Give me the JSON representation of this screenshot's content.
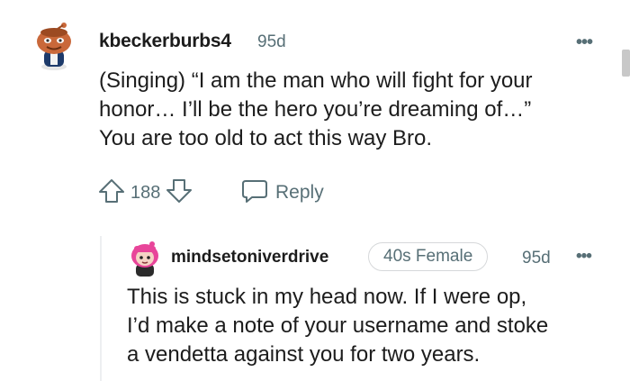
{
  "comment": {
    "username": "kbeckerburbs4",
    "age": "95d",
    "more_icon": "ellipsis-icon",
    "body_lines": [
      "(Singing) “I am the man who will fight for your",
      "honor… I’ll be the hero you’re dreaming of…”",
      "You are too old to act this way Bro."
    ],
    "votes": "188",
    "reply_label": "Reply"
  },
  "reply": {
    "username": "mindsetoniverdrive",
    "flair": "40s Female",
    "age": "95d",
    "more_icon": "ellipsis-icon",
    "body_lines": [
      "This is stuck in my head now. If I were op,",
      "I’d make a note of your username and stoke",
      "a vendetta against you for two years."
    ]
  },
  "colors": {
    "text": "#1c1c1c",
    "meta": "#576f76",
    "avatar1_head": "#c9683a",
    "avatar2_hair": "#e8459a"
  }
}
